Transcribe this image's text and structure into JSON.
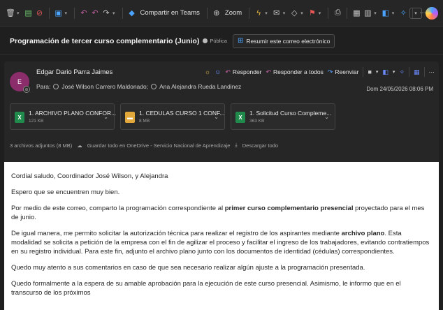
{
  "toolbar": {
    "share_teams": "Compartir en Teams",
    "zoom": "Zoom",
    "more": "···"
  },
  "subject_bar": {
    "subject": "Programación de tercer curso complementario (Junio)",
    "visibility": "Pública",
    "summary_button": "Resumir este correo electrónico"
  },
  "message": {
    "avatar_initial": "E",
    "sender": "Edgar Dario Parra Jaimes",
    "to_label": "Para:",
    "recipients": [
      "José Wilson Carrero Maldonado;",
      "Ana Alejandra Rueda Landinez"
    ],
    "actions": {
      "reply": "Responder",
      "reply_all": "Responder a todos",
      "forward": "Reenviar",
      "more": "···"
    },
    "date": "Dom 24/05/2026 08:06 PM"
  },
  "attachments": [
    {
      "name": "1. ARCHIVO PLANO CONFOR...",
      "size": "121 KB",
      "type": "excel"
    },
    {
      "name": "1. CEDULAS CURSO 1 CONF...",
      "size": "8 MB",
      "type": "folder"
    },
    {
      "name": "1. Solicitud Curso Compleme...",
      "size": "363 KB",
      "type": "excel"
    }
  ],
  "attachment_summary": {
    "count": "3 archivos adjuntos (8 MB)",
    "save": "Guardar todo en OneDrive - Servicio Nacional de Aprendizaje",
    "download": "Descargar todo"
  },
  "body": {
    "greeting": "Cordial saludo, Coordinador José Wilson, y Alejandra",
    "p1": "Espero que se encuentren muy bien.",
    "p2_a": "Por medio de este correo, comparto la programación correspondiente al ",
    "p2_b": "primer curso complementario presencial",
    "p2_c": " proyectado para el mes de junio.",
    "p3_a": "De igual manera, me permito solicitar la autorización técnica para realizar el registro de los aspirantes mediante ",
    "p3_b": "archivo plano",
    "p3_c": ". Esta modalidad se solicita a petición de la empresa con el fin de agilizar el proceso y facilitar el ingreso de los trabajadores, evitando contratiempos en su registro individual. Para este fin, adjunto el archivo plano junto con los documentos de identidad (cédulas) correspondientes.",
    "p4": "Quedo muy atento a sus comentarios en caso de que sea necesario realizar algún ajuste a la programación presentada.",
    "p5": "Quedo formalmente a la espera de su amable aprobación para la ejecución de este curso presencial. Asimismo, le informo que en el transcurso de los próximos"
  },
  "colors": {
    "background": "#1f1f1f",
    "accent": "#4aa3ff",
    "avatar": "#8a2d6a"
  }
}
